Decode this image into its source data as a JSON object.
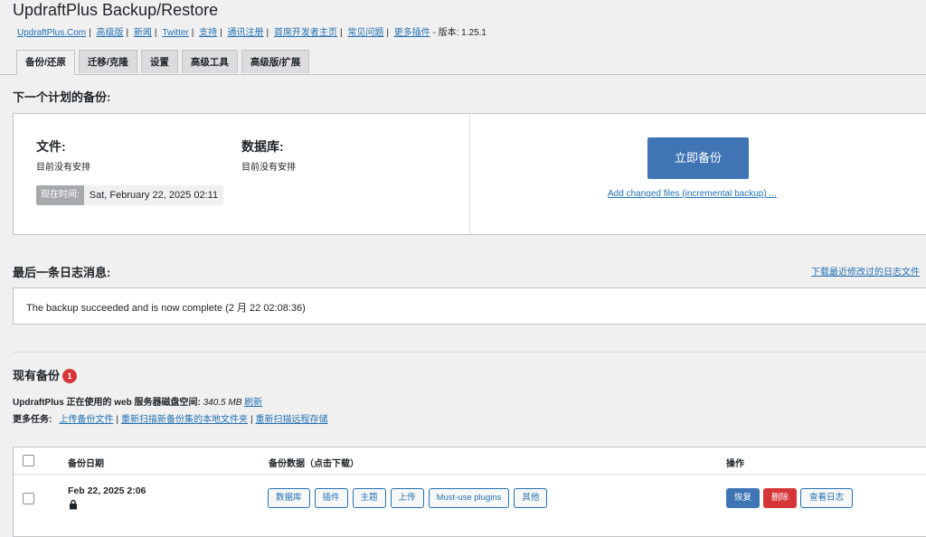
{
  "page": {
    "title": "UpdraftPlus Backup/Restore",
    "links": [
      "UpdraftPlus.Com",
      "高级版",
      "新闻",
      "Twitter",
      "支持",
      "通讯注册",
      "首席开发者主页",
      "常见问题",
      "更多插件"
    ],
    "version_text": "- 版本: 1.25.1"
  },
  "tabs": [
    "备份/还原",
    "迁移/克隆",
    "设置",
    "高级工具",
    "高级版/扩展"
  ],
  "next_backup": {
    "heading": "下一个计划的备份:",
    "files_label": "文件:",
    "files_status": "目前没有安排",
    "db_label": "数据库:",
    "db_status": "目前没有安排",
    "now_label": "现在时间:",
    "now_value": "Sat, February 22, 2025 02:11",
    "backup_now": "立即备份",
    "incremental_link": "Add changed files (incremental backup) ..."
  },
  "log": {
    "heading": "最后一条日志消息:",
    "download_link": "下载最近修改过的日志文件",
    "message": "The backup succeeded and is now complete (2 月 22 02:08:36)"
  },
  "existing": {
    "heading": "现有备份",
    "count": "1",
    "disk_label": "UpdraftPlus 正在使用的 web 服务器磁盘空间:",
    "disk_value": "340.5 MB",
    "refresh": "刷新",
    "more_label": "更多任务:",
    "more_links": [
      "上传备份文件",
      "重新扫描新备份集的本地文件夹",
      "重新扫描远程存储"
    ]
  },
  "table": {
    "headers": [
      "备份日期",
      "备份数据（点击下载）",
      "操作"
    ],
    "rows": [
      {
        "date": "Feb 22, 2025 2:06",
        "data_buttons": [
          "数据库",
          "插件",
          "主题",
          "上传",
          "Must-use plugins",
          "其他"
        ],
        "actions": [
          "恢复",
          "删除",
          "查看日志"
        ]
      }
    ]
  },
  "colors": {
    "primary": "#3f75b4",
    "danger": "#d63638",
    "link": "#2271b1"
  }
}
